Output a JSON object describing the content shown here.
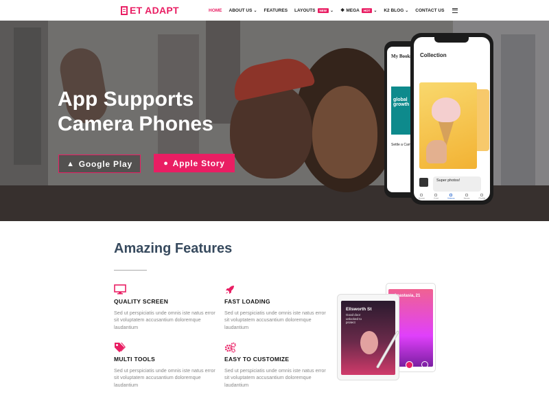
{
  "brand": {
    "logo_text": "ET ADAPT",
    "accent": "#e91e63"
  },
  "nav": {
    "items": [
      {
        "label": "HOME",
        "active": true,
        "caret": false
      },
      {
        "label": "ABOUT US",
        "active": false,
        "caret": true
      },
      {
        "label": "FEATURES",
        "active": false,
        "caret": false
      },
      {
        "label": "LAYOUTS",
        "active": false,
        "caret": true,
        "badge": "NEW"
      },
      {
        "label": "MEGA",
        "active": false,
        "caret": true,
        "badge": "HOT"
      },
      {
        "label": "K2 BLOG",
        "active": false,
        "caret": true
      },
      {
        "label": "CONTACT US",
        "active": false,
        "caret": false
      }
    ]
  },
  "hero": {
    "title_line1": "App Supports",
    "title_line2": "Camera Phones",
    "btn_google": "Google Play",
    "btn_apple": "Apple Story",
    "phone_front": {
      "title": "Collection",
      "chat_text": "Super photos!",
      "tabs": [
        "Home",
        "Grid",
        "Videos",
        "News",
        "Profile"
      ]
    },
    "phone_back": {
      "title": "My Books",
      "book_text": "global growth",
      "caption": "Settle a Came"
    }
  },
  "features": {
    "title": "Amazing Features",
    "items": [
      {
        "icon": "monitor-icon",
        "title": "QUALITY SCREEN",
        "desc": "Sed ut perspiciatis unde omnis iste natus error sit voluptatem accusantium doloremque laudantium"
      },
      {
        "icon": "rocket-icon",
        "title": "FAST LOADING",
        "desc": "Sed ut perspiciatis unde omnis iste natus error sit voluptatem accusantium doloremque laudantium"
      },
      {
        "icon": "tags-icon",
        "title": "MULTI TOOLS",
        "desc": "Sed ut perspiciatis unde omnis iste natus error sit voluptatem accusantium doloremque laudantium"
      },
      {
        "icon": "gears-icon",
        "title": "EASY TO CUSTOMIZE",
        "desc": "Sed ut perspiciatis unde omnis iste natus error sit voluptatem accusantium doloremque laudantium"
      }
    ],
    "tablet_front": {
      "name": "Ellsworth St",
      "sub": "Good door unlocked to protect"
    },
    "tablet_back": {
      "name": "Anastasia, 21"
    }
  }
}
